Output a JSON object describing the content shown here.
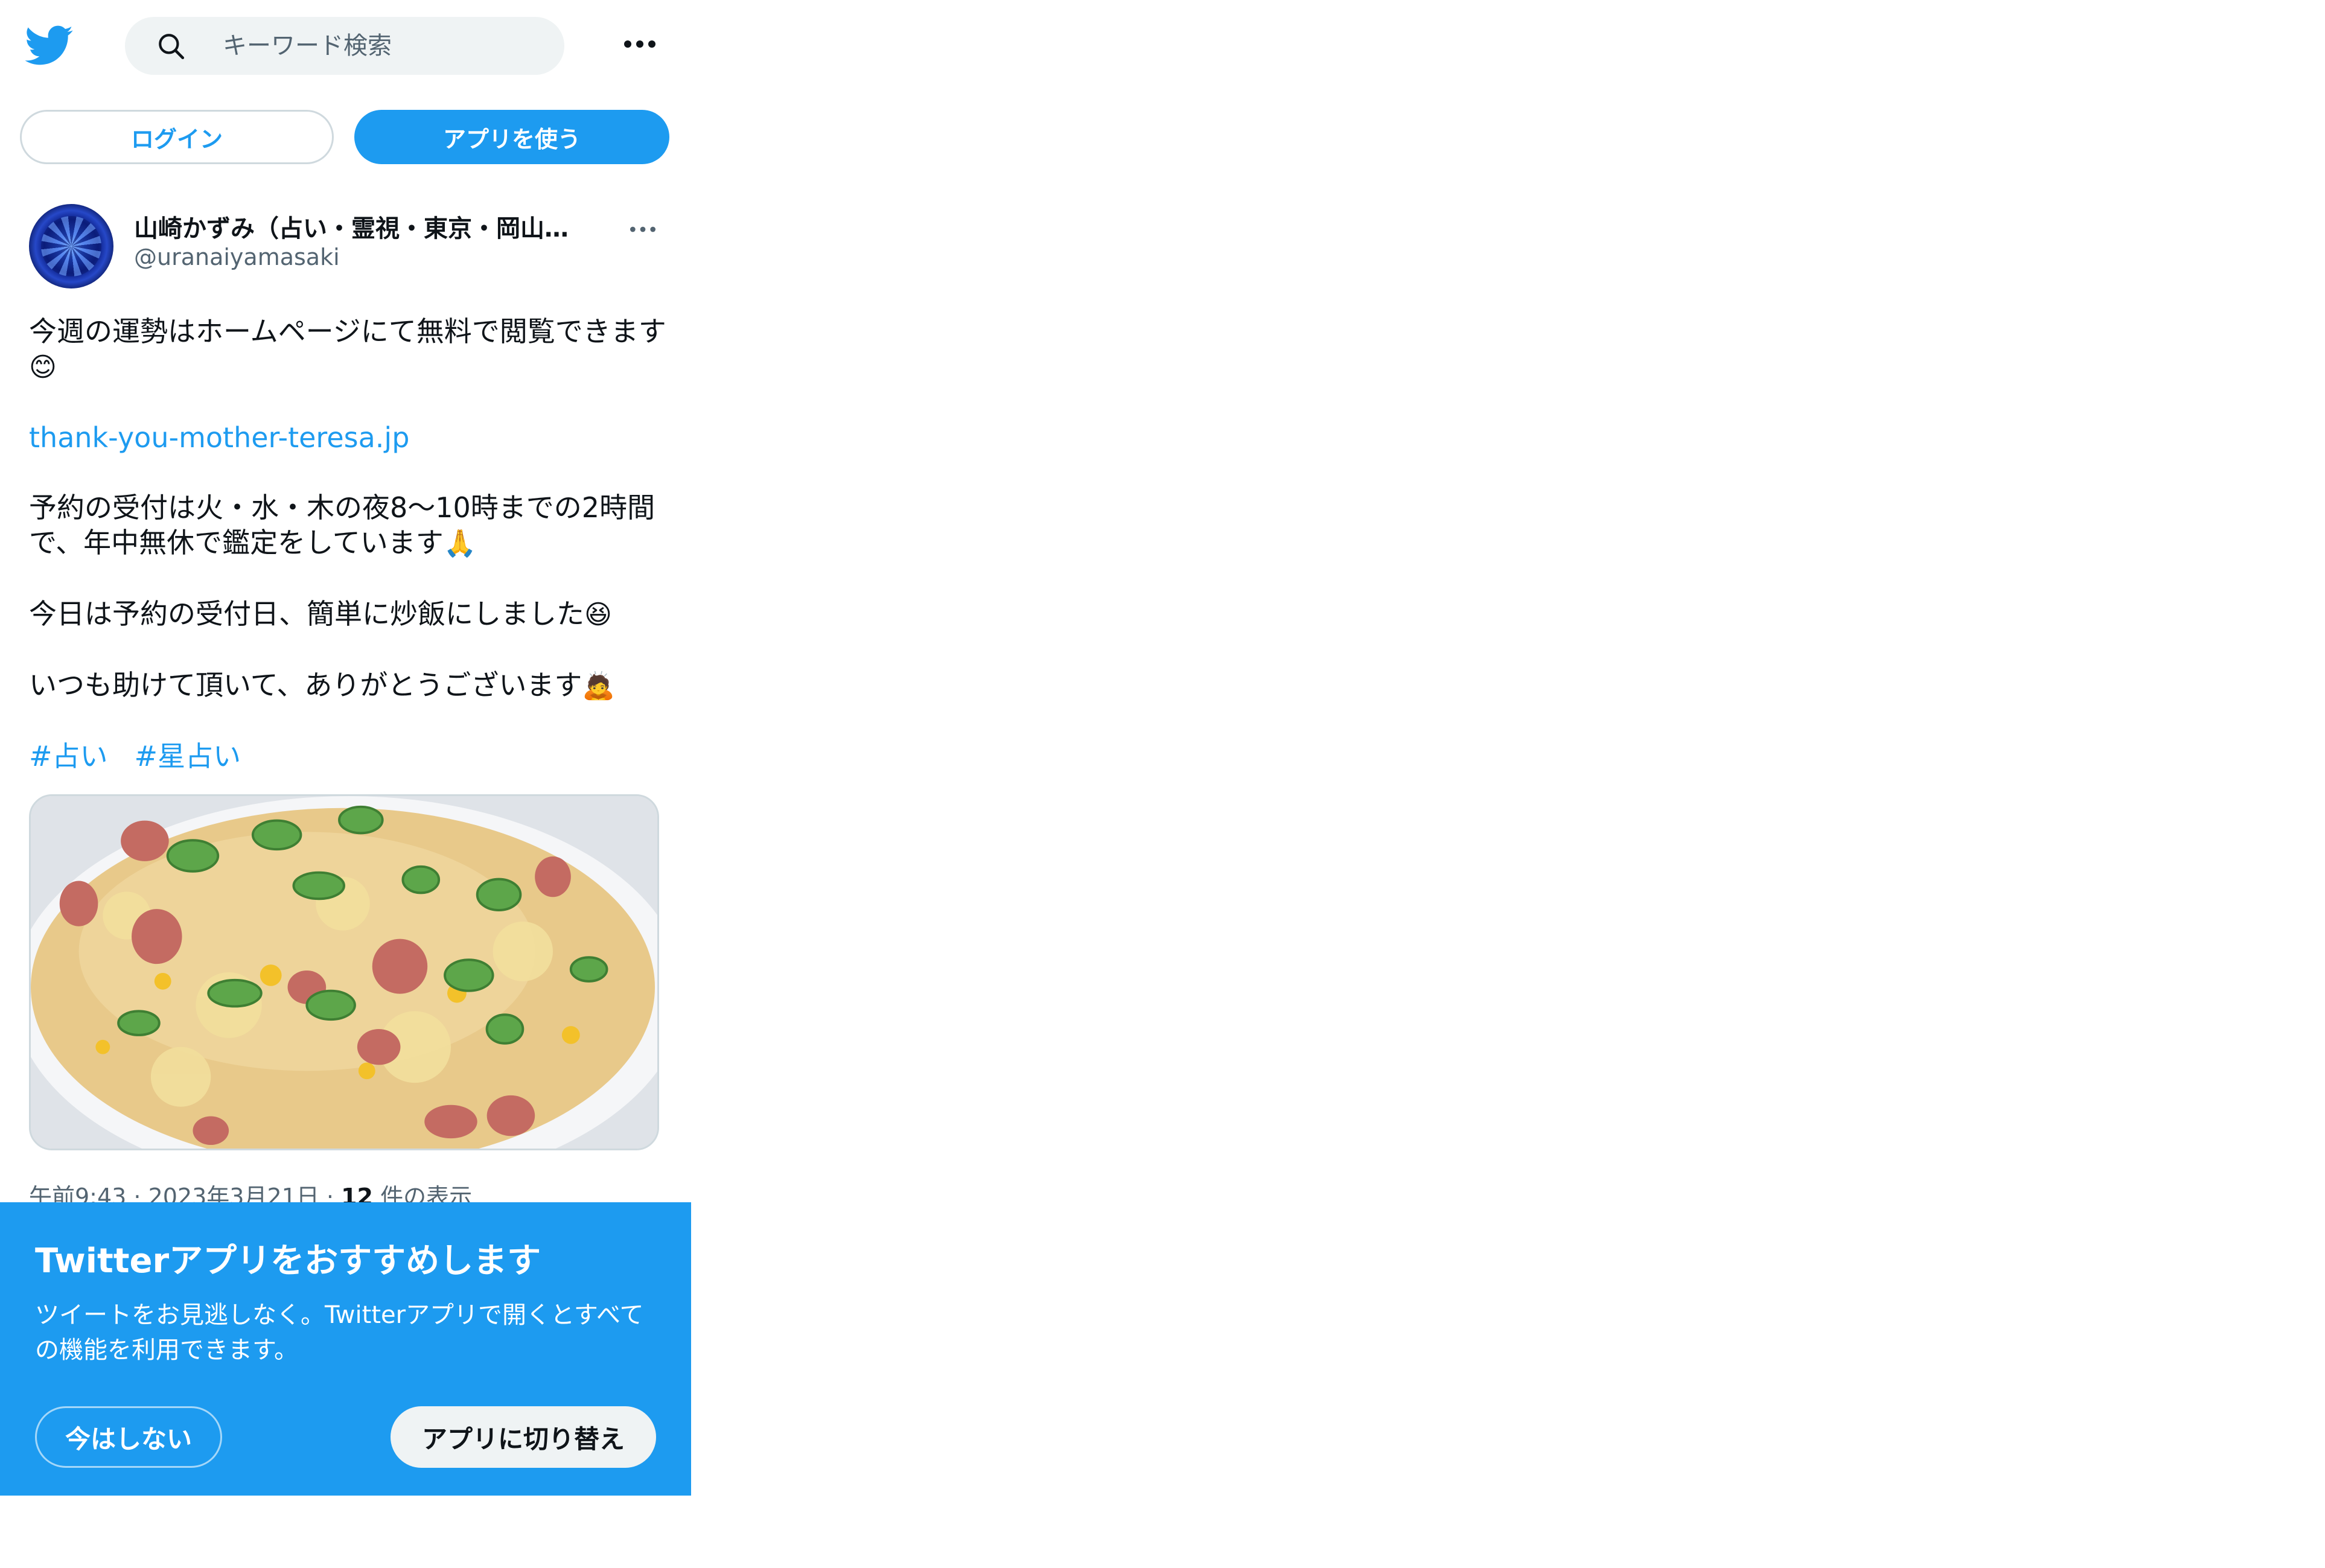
{
  "header": {
    "logo": "twitter-bird-icon",
    "search_placeholder": "キーワード検索",
    "more_icon": "more-horizontal-icon"
  },
  "auth": {
    "login_label": "ログイン",
    "use_app_label": "アプリを使う"
  },
  "tweet": {
    "author": {
      "display_name": "山崎かずみ（占い・霊視・東京・岡山…",
      "handle": "@uranaiyamasaki"
    },
    "paragraphs": {
      "p1": "今週の運勢はホームページにて無料で閲覧できます",
      "p1_emoji": "😊",
      "link": "thank-you-mother-teresa.jp",
      "p3": "予約の受付は火・水・木の夜8〜10時までの2時間で、年中無休で鑑定をしています",
      "p3_emoji": "🙏",
      "p4": "今日は予約の受付日、簡単に炒飯にしました",
      "p4_emoji": "😆",
      "p5": "いつも助けて頂いて、ありがとうございます",
      "p5_emoji": "🙇"
    },
    "hashtags": [
      "#占い",
      "#星占い"
    ],
    "photo_icon": "fried-rice-photo",
    "meta": {
      "time": "午前9:43",
      "sep1": " · ",
      "date": "2023年3月21日",
      "sep2": " · ",
      "views_count": "12",
      "views_label": " 件の表示"
    }
  },
  "banner": {
    "title": "Twitterアプリをおすすめします",
    "description": "ツイートをお見逃しなく。Twitterアプリで開くとすべての機能を利用できます。",
    "not_now_label": "今はしない",
    "switch_label": "アプリに切り替え"
  },
  "colors": {
    "brand_blue": "#1d9bf0",
    "text": "#0f1419",
    "secondary_text": "#536471",
    "search_bg": "#eff3f4"
  }
}
